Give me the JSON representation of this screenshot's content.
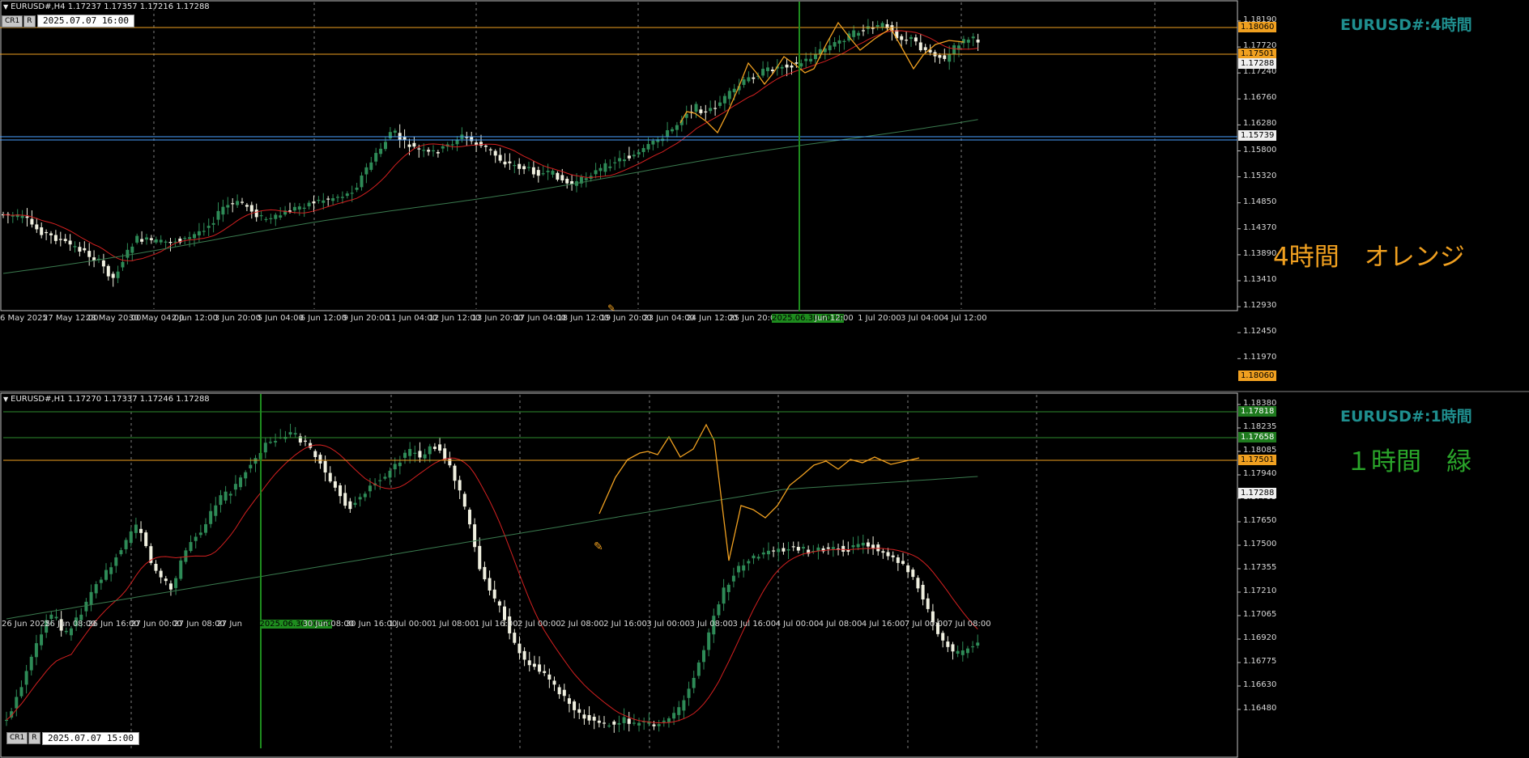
{
  "colors": {
    "background": "#000000",
    "grid": "#808080",
    "bull_candle": "#2e8b57",
    "bear_candle": "#f0f0e0",
    "ma_fast": "#d42020",
    "ma_slow": "#3a7a4e",
    "zigzag": "#f0a020",
    "orange_level": "#f0a020",
    "green_level": "#2e8b2e",
    "blue_level": "#4aa0ff",
    "sym_title": "#1f8f8f",
    "orange_note": "#f0a020",
    "green_note": "#2aa52a",
    "vline": "#1e8c1e"
  },
  "top": {
    "header": "EURUSD#,H4  1.17237 1.17357 1.17216 1.17288",
    "cr_label": "CR1",
    "r_label": "R",
    "date_box": "2025.07.07 16:00",
    "symbol_title": "EURUSD#:4時間",
    "note": "4時間　オレンジ",
    "y_ticks": [
      "1.18190",
      "1.17720",
      "1.17240",
      "1.16760",
      "1.16280",
      "1.15800",
      "1.15320",
      "1.14850",
      "1.14370",
      "1.13890",
      "1.13410",
      "1.12930",
      "1.12450",
      "1.11970"
    ],
    "price_tags": [
      {
        "label": "1.18060",
        "kind": "orange"
      },
      {
        "label": "1.17501",
        "kind": "orange"
      },
      {
        "label": "1.17288",
        "kind": "white"
      },
      {
        "label": "1.15739",
        "kind": "white"
      }
    ],
    "x_labels": [
      "6 May 2025",
      "27 May 12:00",
      "28 May 20:00",
      "30 May 04:00",
      "2 Jun 12:00",
      "3 Jun 20:00",
      "5 Jun 04:00",
      "6 Jun 12:00",
      "9 Jun 20:00",
      "11 Jun 04:00",
      "12 Jun 12:00",
      "13 Jun 20:00",
      "17 Jun 04:00",
      "18 Jun 12:00",
      "19 Jun 20:00",
      "23 Jun 04:00",
      "24 Jun 12:00",
      "25 Jun 20:00",
      "2025.06.30 00:00",
      "Jun 12:00",
      "1 Jul 20:00",
      "3 Jul 04:00",
      "4 Jul 12:00"
    ]
  },
  "bottom": {
    "header": "EURUSD#,H1  1.17270 1.17337 1.17246 1.17288",
    "cr_label": "CR1",
    "r_label": "R",
    "date_box": "2025.07.07 15:00",
    "symbol_title": "EURUSD#:1時間",
    "note": "１時間　緑",
    "y_ticks": [
      "1.18380",
      "1.18235",
      "1.18085",
      "1.17940",
      "1.17795",
      "1.17650",
      "1.17500",
      "1.17355",
      "1.17210",
      "1.17065",
      "1.16920",
      "1.16775",
      "1.16630",
      "1.16480"
    ],
    "price_tags": [
      {
        "label": "1.18060",
        "kind": "orange"
      },
      {
        "label": "1.17818",
        "kind": "green"
      },
      {
        "label": "1.17658",
        "kind": "green"
      },
      {
        "label": "1.17501",
        "kind": "orange"
      },
      {
        "label": "1.17288",
        "kind": "white"
      }
    ],
    "x_labels": [
      "26 Jun 2025",
      "26 Jun 08:00",
      "26 Jun 16:00",
      "27 Jun 00:00",
      "27 Jun 08:00",
      "27 Jun",
      "2025.06.30 00:00",
      "30 Jun 08:00",
      "30 Jun 16:00",
      "1 Jul 00:00",
      "1 Jul 08:00",
      "1 Jul 16:00",
      "2 Jul 00:00",
      "2 Jul 08:00",
      "2 Jul 16:00",
      "3 Jul 00:00",
      "3 Jul 08:00",
      "3 Jul 16:00",
      "4 Jul 00:00",
      "4 Jul 08:00",
      "4 Jul 16:00",
      "7 Jul 00:00",
      "7 Jul 08:00"
    ]
  }
}
